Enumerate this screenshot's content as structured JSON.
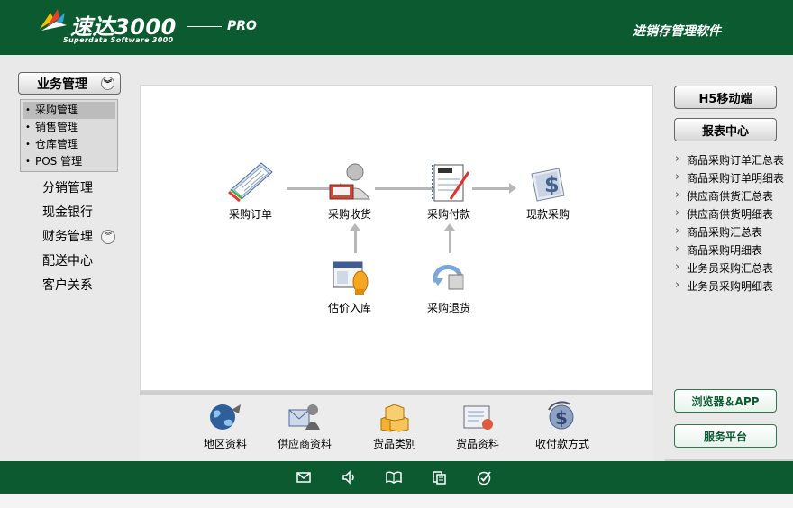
{
  "header": {
    "brand": "速达3000",
    "edition": "PRO",
    "subtitle": "Superdata Software 3000",
    "tagline": "进销存管理软件"
  },
  "left_nav": {
    "module_button": "业务管理",
    "submenu": [
      "采购管理",
      "销售管理",
      "仓库管理",
      "POS 管理"
    ],
    "active_submenu": "采购管理",
    "items": [
      "分销管理",
      "现金银行",
      "财务管理",
      "配送中心",
      "客户关系"
    ]
  },
  "workflow": {
    "purchase_order": "采购订单",
    "purchase_receipt": "采购收货",
    "purchase_payment": "采购付款",
    "cash_purchase": "现款采购",
    "estimated_stock_in": "估价入库",
    "purchase_return": "采购退货"
  },
  "bottom_shortcuts": [
    "地区资料",
    "供应商资料",
    "货品类别",
    "货品资料",
    "收付款方式"
  ],
  "right_panel": {
    "mobile_button": "H5移动端",
    "report_button": "报表中心",
    "reports": [
      "商品采购订单汇总表",
      "商品采购订单明细表",
      "供应商供货汇总表",
      "供应商供货明细表",
      "商品采购汇总表",
      "商品采购明细表",
      "业务员采购汇总表",
      "业务员采购明细表"
    ],
    "browser_app_button": "浏览器＆APP",
    "service_button": "服务平台"
  },
  "footer_icons": [
    "mail-icon",
    "speaker-icon",
    "book-icon",
    "document-icon",
    "check-icon"
  ],
  "colors": {
    "brand_green": "#0b5a30",
    "panel_bg": "#e9e9e9",
    "arrow_gray": "#b7b7b7"
  }
}
